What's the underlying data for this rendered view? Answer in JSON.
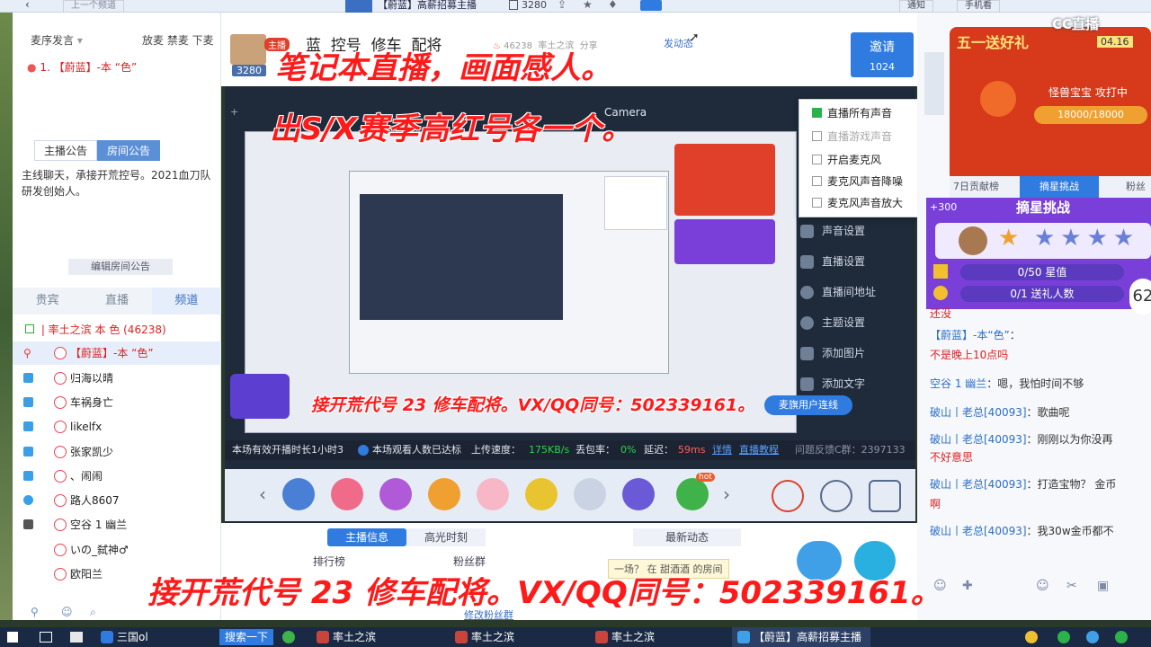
{
  "app": {
    "room_title": "【蔚蓝】高薪招募主播",
    "viewer_count": "3280",
    "notify_label": "通知",
    "mobile_label": "手机看",
    "brand": "CC直播",
    "top_left_tab": "上一个频道"
  },
  "left": {
    "mic_mode": "麦序发言",
    "mic_controls": "放麦 禁麦 下麦",
    "mic_queue_item": "1. 【蔚蓝】-本 “色”",
    "announce_tabs": [
      "主播公告",
      "房间公告"
    ],
    "announcement": "主线聊天，承接开荒控号。2021血刀队研发创始人。",
    "edit_announce": "编辑房间公告",
    "member_tabs": [
      "贵宾",
      "直播",
      "频道"
    ],
    "channel_header": "| 率土之滨 本 色 (46238)",
    "users": [
      "【蔚蓝】-本 “色”",
      "归海以晴",
      "车祸身亡",
      "likelfx",
      "张家凯少",
      "、闹闹",
      "路人8607",
      "空谷 1 幽兰",
      "いの_弑神♂",
      "欧阳兰"
    ]
  },
  "header": {
    "anchor_badge": "主播",
    "anchor_count": "3280",
    "nav": [
      "蓝",
      "控号",
      "修车",
      "配将"
    ],
    "heat": "46238",
    "live_tags": [
      "率土之滨",
      "分享"
    ],
    "follow_label": "发动态",
    "invite_label": "邀请",
    "invite_count": "1024"
  },
  "stage": {
    "camera_tab": "Camera",
    "status_text": "本场有效开播时长1小时3",
    "viewer_status": "本场观看人数已达标",
    "upload_label": "上传速度：",
    "upload_value": "175KB/s",
    "loss_label": "丢包率：",
    "loss_value": "0%",
    "delay_label": "延迟：",
    "delay_value": "59ms",
    "details_label": "详情",
    "tutorial_label": "直播教程",
    "feedback_label": "问题反馈C群：2397133",
    "link_button": "麦旗用户连线",
    "hot_badge": "hot"
  },
  "popup": {
    "options": [
      "直播所有声音",
      "直播游戏声音",
      "开启麦克风",
      "麦克风声音降噪",
      "麦克风声音放大"
    ],
    "checked": 0
  },
  "sidemenu": [
    "声音设置",
    "直播设置",
    "直播间地址",
    "主题设置",
    "添加图片",
    "添加文字"
  ],
  "below": {
    "tabs": [
      "主播信息",
      "高光时刻"
    ],
    "news_label": "最新动态",
    "rank_label": "排行榜",
    "fans_label": "粉丝群",
    "room_hint": "一场？ 在 甜酒酒 的房间",
    "edit_fans": "修改粉丝群"
  },
  "right": {
    "promo_title": "五一送好礼",
    "promo_date": "04.16",
    "boss_label": "怪兽宝宝 攻打中",
    "boss_hp": "18000/18000",
    "day_rank": "7日贡献榜",
    "challenge_tab": "摘星挑战",
    "fans_tab": "粉丝",
    "plus_label": "+300",
    "challenge_title": "摘星挑战",
    "star_progress": "0/50 星值",
    "gift_progress": "0/1 送礼人数",
    "side_num": "62",
    "chat": [
      {
        "name": "",
        "text": "还没"
      },
      {
        "name": "【蔚蓝】-本“色”",
        "text": "："
      },
      {
        "name": "",
        "text": "不是晚上10点吗"
      },
      {
        "name": "空谷 1 幽兰",
        "text": "：嗯，我怕时间不够"
      },
      {
        "name": "破山丨老总[40093]",
        "text": "：歌曲呢"
      },
      {
        "name": "破山丨老总[40093]",
        "text": "：刚刚以为你没再"
      },
      {
        "name": "",
        "text": "不好意思"
      },
      {
        "name": "破山丨老总[40093]",
        "text": "：打造宝物？ 金币"
      },
      {
        "name": "",
        "text": "啊"
      },
      {
        "name": "破山丨老总[40093]",
        "text": "：我30w金币都不"
      }
    ]
  },
  "overlays": {
    "line1": "笔记本直播，画面感人。",
    "line2": "出S/X赛季高红号各一个。",
    "line3": "接开荒代号 23 修车配将。VX/QQ同号：502339161。",
    "line4": "接开荒代号 23 修车配将。VX/QQ同号：502339161。"
  },
  "taskbar": {
    "search": "搜索一下",
    "items": [
      "三国ol",
      "率土之滨",
      "率土之滨",
      "率土之滨",
      "【蔚蓝】高薪招募主播"
    ]
  },
  "colors": {
    "accent": "#2f7be0",
    "overlay_red": "#ff1a1a",
    "status_green": "#2bb34a",
    "purple": "#7a3fd8"
  }
}
